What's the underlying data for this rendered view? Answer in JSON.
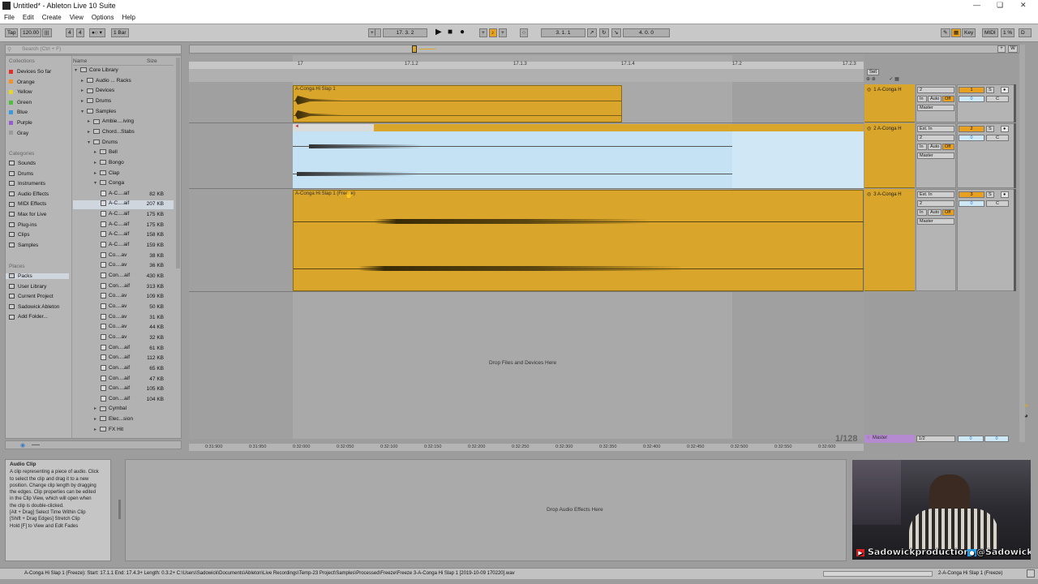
{
  "window": {
    "title": "Untitled* - Ableton Live 10 Suite"
  },
  "menu": [
    "File",
    "Edit",
    "Create",
    "View",
    "Options",
    "Help"
  ],
  "transport": {
    "tap": "Tap",
    "tempo": "120.00",
    "sig_num": "4",
    "sig_den": "4",
    "quant": "1 Bar",
    "position": "17.   3.   2",
    "loop_start": "3.   1.   1",
    "loop_length": "4.   0.   0",
    "key": "Key",
    "midi": "MIDI",
    "cpu": "1 %"
  },
  "browser": {
    "search_placeholder": "Search (Ctrl + F)",
    "collections_label": "Collections",
    "collections": [
      {
        "label": "Devices So far",
        "color": "#e0302a"
      },
      {
        "label": "Orange",
        "color": "#f2902a"
      },
      {
        "label": "Yellow",
        "color": "#e5d42a"
      },
      {
        "label": "Green",
        "color": "#4fbf3a"
      },
      {
        "label": "Blue",
        "color": "#3a9ae0"
      },
      {
        "label": "Purple",
        "color": "#9a5ad0"
      },
      {
        "label": "Gray",
        "color": "#9a9a9a"
      }
    ],
    "categories_label": "Categories",
    "categories": [
      "Sounds",
      "Drums",
      "Instruments",
      "Audio Effects",
      "MIDI Effects",
      "Max for Live",
      "Plug-ins",
      "Clips",
      "Samples"
    ],
    "places_label": "Places",
    "places": [
      "Packs",
      "User Library",
      "Current Project",
      "Sadowick Ableton",
      "Add Folder..."
    ],
    "col_name": "Name",
    "col_size": "Size",
    "tree": [
      {
        "label": "Core Library",
        "indent": 0,
        "type": "folder",
        "open": true
      },
      {
        "label": "Audio ... Racks",
        "indent": 1,
        "type": "folder"
      },
      {
        "label": "Devices",
        "indent": 1,
        "type": "folder"
      },
      {
        "label": "Drums",
        "indent": 1,
        "type": "folder"
      },
      {
        "label": "Samples",
        "indent": 1,
        "type": "folder",
        "open": true
      },
      {
        "label": "Ambie....iving",
        "indent": 2,
        "type": "folder"
      },
      {
        "label": "Chord...Stabs",
        "indent": 2,
        "type": "folder"
      },
      {
        "label": "Drums",
        "indent": 2,
        "type": "folder",
        "open": true
      },
      {
        "label": "Bell",
        "indent": 3,
        "type": "folder"
      },
      {
        "label": "Bongo",
        "indent": 3,
        "type": "folder"
      },
      {
        "label": "Clap",
        "indent": 3,
        "type": "folder"
      },
      {
        "label": "Conga",
        "indent": 3,
        "type": "folder",
        "open": true
      },
      {
        "label": "A-C....aif",
        "indent": 4,
        "type": "file",
        "size": "82 KB"
      },
      {
        "label": "A-C....aif",
        "indent": 4,
        "type": "file",
        "size": "207 KB",
        "selected": true
      },
      {
        "label": "A-C....aif",
        "indent": 4,
        "type": "file",
        "size": "175 KB"
      },
      {
        "label": "A-C....aif",
        "indent": 4,
        "type": "file",
        "size": "175 KB"
      },
      {
        "label": "A-C....aif",
        "indent": 4,
        "type": "file",
        "size": "158 KB"
      },
      {
        "label": "A-C....aif",
        "indent": 4,
        "type": "file",
        "size": "159 KB"
      },
      {
        "label": "Co....av",
        "indent": 4,
        "type": "file",
        "size": "38 KB"
      },
      {
        "label": "Co....av",
        "indent": 4,
        "type": "file",
        "size": "36 KB"
      },
      {
        "label": "Con....aif",
        "indent": 4,
        "type": "file",
        "size": "430 KB"
      },
      {
        "label": "Con....aif",
        "indent": 4,
        "type": "file",
        "size": "313 KB"
      },
      {
        "label": "Co....av",
        "indent": 4,
        "type": "file",
        "size": "109 KB"
      },
      {
        "label": "Co....av",
        "indent": 4,
        "type": "file",
        "size": "50 KB"
      },
      {
        "label": "Co....av",
        "indent": 4,
        "type": "file",
        "size": "31 KB"
      },
      {
        "label": "Co....av",
        "indent": 4,
        "type": "file",
        "size": "44 KB"
      },
      {
        "label": "Co....av",
        "indent": 4,
        "type": "file",
        "size": "32 KB"
      },
      {
        "label": "Con....aif",
        "indent": 4,
        "type": "file",
        "size": "61 KB"
      },
      {
        "label": "Con....aif",
        "indent": 4,
        "type": "file",
        "size": "112 KB"
      },
      {
        "label": "Con....aif",
        "indent": 4,
        "type": "file",
        "size": "65 KB"
      },
      {
        "label": "Con....aif",
        "indent": 4,
        "type": "file",
        "size": "47 KB"
      },
      {
        "label": "Con....aif",
        "indent": 4,
        "type": "file",
        "size": "105 KB"
      },
      {
        "label": "Con....aif",
        "indent": 4,
        "type": "file",
        "size": "104 KB"
      },
      {
        "label": "Cymbal",
        "indent": 3,
        "type": "folder"
      },
      {
        "label": "Elec...sion",
        "indent": 3,
        "type": "folder"
      },
      {
        "label": "FX Hit",
        "indent": 3,
        "type": "folder"
      }
    ]
  },
  "arrangement": {
    "bar_markers": [
      "17",
      "17.1.2",
      "17.1.3",
      "17.1.4",
      "17.2",
      "17.2.3"
    ],
    "time_markers": [
      "0:31:900",
      "0:31:950",
      "0:32:000",
      "0:32:050",
      "0:32:100",
      "0:32:150",
      "0:32:200",
      "0:32:250",
      "0:32:300",
      "0:32:350",
      "0:32:400",
      "0:32:450",
      "0:32:500",
      "0:32:550",
      "0:32:600"
    ],
    "clip1": "A-Conga Hi Slap 1",
    "clip3": "A-Conga Hi Slap 1 (Freeze)",
    "drop_text": "Drop Files and Devices Here",
    "zoom": "1/128",
    "set_label": "Set"
  },
  "tracks": [
    {
      "name": "1 A-Conga H",
      "input": "",
      "channel": "2",
      "monitor_in": "In",
      "monitor_auto": "Auto",
      "monitor_off": "Off",
      "output": "Master",
      "number": "1",
      "volume": "0",
      "pan": "C",
      "solo": "S"
    },
    {
      "name": "2 A-Conga H",
      "input": "Ext. In",
      "channel": "2",
      "monitor_in": "In",
      "monitor_auto": "Auto",
      "monitor_off": "Off",
      "output": "Master",
      "number": "2",
      "volume": "0",
      "pan": "C",
      "solo": "S"
    },
    {
      "name": "3 A-Conga H",
      "input": "Ext. In",
      "channel": "2",
      "monitor_in": "In",
      "monitor_auto": "Auto",
      "monitor_off": "Off",
      "output": "Master",
      "number": "3",
      "volume": "0",
      "pan": "C",
      "solo": "S"
    }
  ],
  "master": {
    "name": "Master",
    "routing": "1/2",
    "volume": "0",
    "pan": "0"
  },
  "info": {
    "title": "Audio Clip",
    "body": [
      "A clip representing a piece of audio. Click",
      "to select the clip and drag it to a new",
      "position. Change clip length by dragging",
      "the edges. Clip properties can be edited",
      "in the Clip View, which will open when",
      "the clip is double-clicked.",
      "[Alt + Drag] Select Time Within Clip",
      "[Shift + Drag Edges] Stretch Clip",
      "Hold [F] to View and Edit Fades"
    ]
  },
  "detail": {
    "drop_text": "Drop Audio Effects Here"
  },
  "status": {
    "text": "A-Conga Hi Slap 1 (Freeze): Start: 17.1.1  End: 17.4.3+  Length: 0.3.2+  C:\\Users\\Sadowick\\Documents\\Ableton\\Live Recordings\\Temp-23 Project\\Samples\\Processed\\Freeze\\Freeze 3-A-Conga Hi Slap 1 [2019-10-09 170220].wav",
    "right": "2-A-Conga Hi Slap 1 (Freeze)"
  },
  "webcam": {
    "youtube": "Sadowickproduction",
    "twitter": "@Sadowick"
  }
}
